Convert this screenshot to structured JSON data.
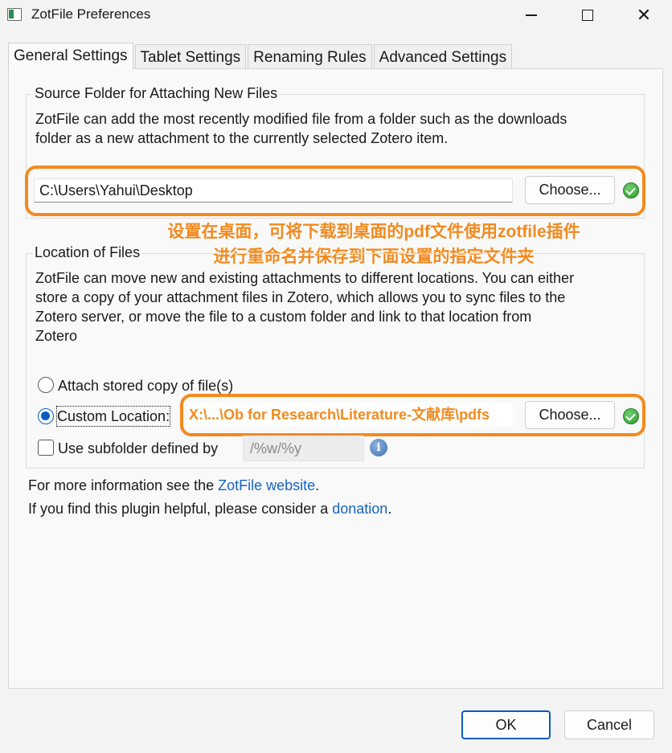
{
  "window": {
    "title": "ZotFile Preferences",
    "controls": {
      "minimize": "—",
      "maximize": "☐",
      "close": "✕"
    }
  },
  "tabs": [
    {
      "label": "General Settings",
      "active": true
    },
    {
      "label": "Tablet Settings",
      "active": false
    },
    {
      "label": "Renaming Rules",
      "active": false
    },
    {
      "label": "Advanced Settings",
      "active": false
    }
  ],
  "source_folder": {
    "legend": "Source Folder for Attaching New Files",
    "description_line1": "ZotFile can add the most recently modified file from a folder such as the downloads",
    "description_line2": "folder as a new attachment to the currently selected Zotero item.",
    "path": "C:\\Users\\Yahui\\Desktop",
    "choose_label": "Choose...",
    "status_icon": "check-circle-icon"
  },
  "annotation": {
    "line1": "设置在桌面，可将下载到桌面的pdf文件使用zotfile插件",
    "line2": "进行重命名并保存到下面设置的指定文件夹",
    "color": "#f28a1e"
  },
  "location_of_files": {
    "legend": "Location of Files",
    "description_line1": "ZotFile can move new and existing attachments to different locations. You can either",
    "description_line2": "store a copy of your attachment files in Zotero, which allows you to sync files to the",
    "description_line3": "Zotero server, or move the file to a custom folder and link to that location from",
    "description_line4": "Zotero",
    "option_stored": "Attach stored copy of file(s)",
    "option_custom": "Custom Location:",
    "selected": "custom",
    "custom_path": "X:\\...\\Ob for Research\\Literature-文献库\\pdfs",
    "choose_label": "Choose...",
    "subfolder_label": "Use subfolder defined by",
    "subfolder_checked": false,
    "subfolder_value": "/%w/%y",
    "info_icon": "info-icon"
  },
  "footer": {
    "more_info_prefix": "For more information see the ",
    "more_info_link": "ZotFile website",
    "more_info_suffix": ".",
    "donation_prefix": "If you find this plugin helpful, please consider a ",
    "donation_link": "donation",
    "donation_suffix": "."
  },
  "buttons": {
    "ok": "OK",
    "cancel": "Cancel"
  },
  "colors": {
    "accent": "#0a5cc2",
    "highlight": "#f28a1e",
    "link": "#1565c0"
  }
}
